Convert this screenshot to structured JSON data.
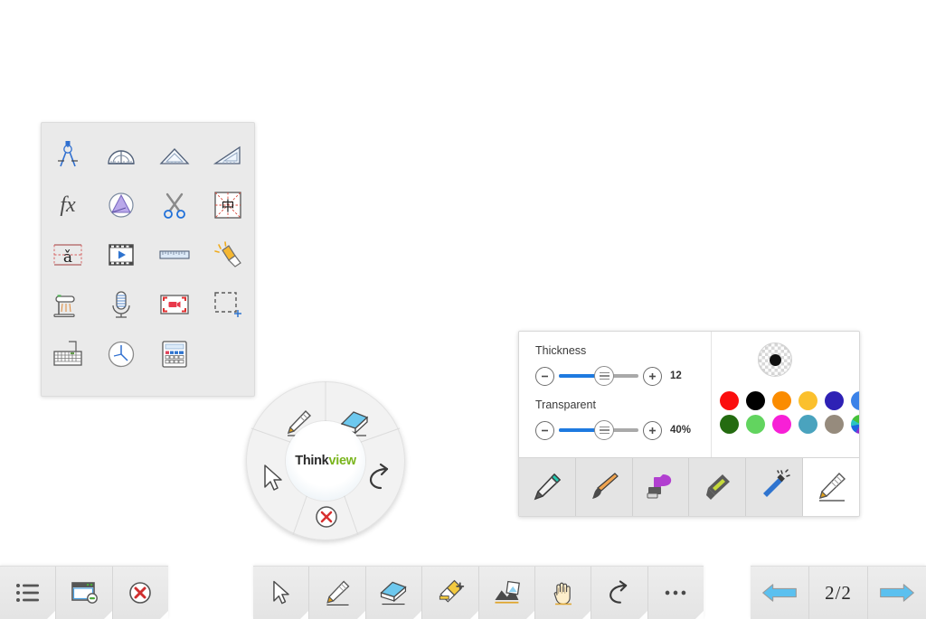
{
  "app": {
    "logo_primary": "Think",
    "logo_secondary": "view"
  },
  "tools_panel": {
    "items": [
      {
        "name": "compass",
        "label": "Compass"
      },
      {
        "name": "protractor",
        "label": "Protractor"
      },
      {
        "name": "isoceles-triangle-ruler",
        "label": "Isoceles Triangle Ruler"
      },
      {
        "name": "right-triangle-ruler",
        "label": "Right Triangle Ruler"
      },
      {
        "name": "formula-fx",
        "label": "fx"
      },
      {
        "name": "3d-shapes",
        "label": "3D Shapes"
      },
      {
        "name": "scissors",
        "label": "Scissors"
      },
      {
        "name": "chinese-grid",
        "label": "Tian Zi Ge"
      },
      {
        "name": "pinyin-a",
        "label": "Pinyin"
      },
      {
        "name": "video-player",
        "label": "Video"
      },
      {
        "name": "ruler",
        "label": "Ruler"
      },
      {
        "name": "spotlight",
        "label": "Spotlight"
      },
      {
        "name": "document-camera",
        "label": "Document Camera"
      },
      {
        "name": "microphone",
        "label": "Microphone"
      },
      {
        "name": "screen-recorder",
        "label": "Screen Recorder"
      },
      {
        "name": "screenshot",
        "label": "Screenshot"
      },
      {
        "name": "on-screen-keyboard",
        "label": "Keyboard"
      },
      {
        "name": "clock",
        "label": "Clock"
      },
      {
        "name": "calculator",
        "label": "Calculator"
      }
    ]
  },
  "radial_menu": {
    "segments": [
      {
        "name": "pen",
        "label": "Pen"
      },
      {
        "name": "eraser",
        "label": "Eraser"
      },
      {
        "name": "select-cursor",
        "label": "Select"
      },
      {
        "name": "undo",
        "label": "Undo"
      },
      {
        "name": "close",
        "label": "Close"
      }
    ]
  },
  "pen_panel": {
    "thickness": {
      "label": "Thickness",
      "value": "12",
      "percent": 50,
      "min_label": "−",
      "max_label": "+"
    },
    "transparent": {
      "label": "Transparent",
      "value": "40%",
      "percent": 50,
      "min_label": "−",
      "max_label": "+"
    },
    "preview": {
      "name": "color-preview",
      "color": "#111111"
    },
    "colors": [
      {
        "name": "red",
        "hex": "#fb0d0d"
      },
      {
        "name": "black",
        "hex": "#000000"
      },
      {
        "name": "orange",
        "hex": "#fb8c00"
      },
      {
        "name": "gold",
        "hex": "#fbc02d"
      },
      {
        "name": "indigo",
        "hex": "#2e21b5"
      },
      {
        "name": "blue",
        "hex": "#3b82e8"
      },
      {
        "name": "dark-green",
        "hex": "#246b10"
      },
      {
        "name": "light-green",
        "hex": "#62d45f"
      },
      {
        "name": "magenta",
        "hex": "#f720d6"
      },
      {
        "name": "teal",
        "hex": "#4aa3be"
      },
      {
        "name": "taupe",
        "hex": "#968b7d"
      },
      {
        "name": "rainbow",
        "hex": "rainbow"
      }
    ],
    "pen_types": [
      {
        "name": "pencil-tool",
        "label": "Pencil",
        "active": false
      },
      {
        "name": "brush-tool",
        "label": "Brush",
        "active": false
      },
      {
        "name": "marker-tool",
        "label": "Marker",
        "active": false
      },
      {
        "name": "highlighter-tool",
        "label": "Highlighter",
        "active": false
      },
      {
        "name": "magic-pen-tool",
        "label": "Magic Pen",
        "active": false
      },
      {
        "name": "sketch-pencil-tool",
        "label": "Sketch Pencil",
        "active": true
      }
    ]
  },
  "bottom_left_bar": {
    "items": [
      {
        "name": "menu-list",
        "label": "Menu"
      },
      {
        "name": "minimize-window",
        "label": "Minimize"
      },
      {
        "name": "close-app",
        "label": "Exit"
      }
    ]
  },
  "bottom_center_bar": {
    "items": [
      {
        "name": "select-cursor",
        "label": "Select"
      },
      {
        "name": "pen",
        "label": "Pen"
      },
      {
        "name": "eraser",
        "label": "Eraser"
      },
      {
        "name": "clean-brush",
        "label": "Clear"
      },
      {
        "name": "insert-shape",
        "label": "Insert"
      },
      {
        "name": "pan-hand",
        "label": "Roam"
      },
      {
        "name": "undo",
        "label": "Undo"
      },
      {
        "name": "more",
        "label": "More"
      }
    ]
  },
  "bottom_right_bar": {
    "prev_label": "Previous Page",
    "page_indicator": "2/2",
    "next_label": "Next Page"
  }
}
